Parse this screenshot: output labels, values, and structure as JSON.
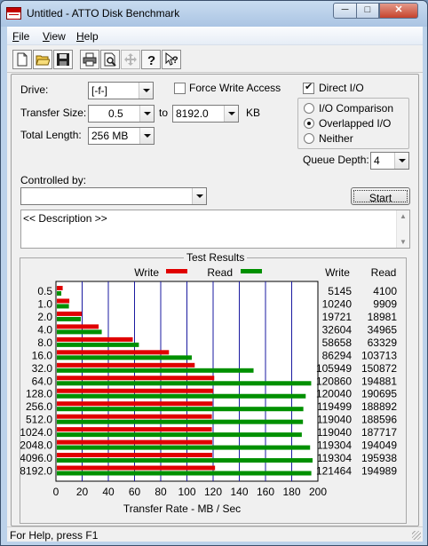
{
  "window": {
    "title": "Untitled - ATTO Disk Benchmark",
    "controls": {
      "minimize": "─",
      "maximize": "□",
      "close": "✕"
    }
  },
  "menu": [
    {
      "label": "File",
      "key": "F",
      "rest": "ile"
    },
    {
      "label": "View",
      "key": "V",
      "rest": "iew"
    },
    {
      "label": "Help",
      "key": "H",
      "rest": "elp"
    }
  ],
  "toolbar_icons": [
    "new-icon",
    "open-icon",
    "save-icon",
    "print-icon",
    "print-preview-icon",
    "move-icon",
    "help-icon",
    "context-help-icon"
  ],
  "settings": {
    "drive_label": "Drive:",
    "drive_value": "[-f-]",
    "force_write_label": "Force Write Access",
    "force_write_checked": false,
    "direct_io_label": "Direct I/O",
    "direct_io_checked": true,
    "transfer_size_label": "Transfer Size:",
    "transfer_from": "0.5",
    "to_label": "to",
    "transfer_to": "8192.0",
    "unit_label": "KB",
    "total_length_label": "Total Length:",
    "total_length_value": "256 MB",
    "io_options": [
      {
        "label": "I/O Comparison",
        "selected": false
      },
      {
        "label": "Overlapped I/O",
        "selected": true
      },
      {
        "label": "Neither",
        "selected": false
      }
    ],
    "queue_depth_label": "Queue Depth:",
    "queue_depth_value": "4",
    "controlled_by_label": "Controlled by:",
    "controlled_by_value": "",
    "start_label": "Start",
    "description_text": "<< Description >>"
  },
  "results": {
    "title": "Test Results",
    "legend_write": "Write",
    "legend_read": "Read",
    "col_write": "Write",
    "col_read": "Read",
    "write_color": "#e00000",
    "read_color": "#009000"
  },
  "chart_data": {
    "type": "bar",
    "orientation": "horizontal",
    "title": "Test Results",
    "xlabel": "Transfer Rate - MB / Sec",
    "xlim": [
      0,
      200
    ],
    "xticks": [
      0,
      20,
      40,
      60,
      80,
      100,
      120,
      140,
      160,
      180,
      200
    ],
    "grid": true,
    "legend": "top",
    "categories": [
      "0.5",
      "1.0",
      "2.0",
      "4.0",
      "8.0",
      "16.0",
      "32.0",
      "64.0",
      "128.0",
      "256.0",
      "512.0",
      "1024.0",
      "2048.0",
      "4096.0",
      "8192.0"
    ],
    "series": [
      {
        "name": "Write",
        "color": "#e00000",
        "values": [
          5145,
          10240,
          19721,
          32604,
          58658,
          86294,
          105949,
          120860,
          120040,
          119499,
          119040,
          119040,
          119304,
          119304,
          121464
        ]
      },
      {
        "name": "Read",
        "color": "#009000",
        "values": [
          4100,
          9909,
          18981,
          34965,
          63329,
          103713,
          150872,
          194881,
          190695,
          188892,
          188596,
          187717,
          194049,
          195938,
          194989
        ]
      }
    ]
  },
  "status": {
    "text": "For Help, press F1"
  }
}
